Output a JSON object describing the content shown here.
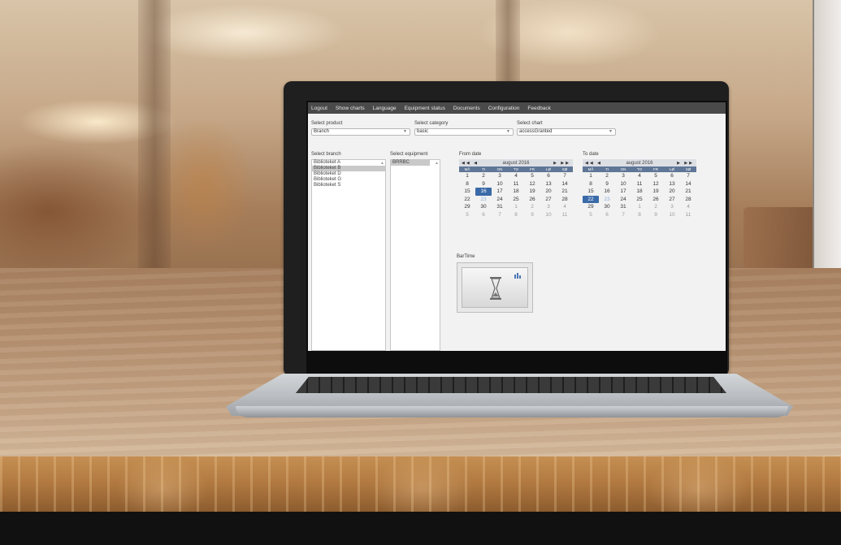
{
  "menu": [
    "Logout",
    "Show charts",
    "Language",
    "Equipment status",
    "Documents",
    "Configuration",
    "Feedback"
  ],
  "filters": {
    "product": {
      "label": "Select product",
      "value": "Branch"
    },
    "category": {
      "label": "Select category",
      "value": "basic"
    },
    "chart": {
      "label": "Select chart",
      "value": "accessGranted"
    }
  },
  "branch": {
    "label": "Select branch",
    "items": [
      "Biblioteket A",
      "Biblioteket B",
      "Biblioteket D",
      "Biblioteket G",
      "Biblioteket S"
    ],
    "selected_index": 1
  },
  "equipment": {
    "label": "Select equipment",
    "items": [
      "BRRBC"
    ],
    "selected_index": 0
  },
  "from_date": {
    "label": "From date",
    "month": "august 2016",
    "nav_prev": "◀◀ ◀",
    "nav_next": "▶ ▶▶",
    "weekdays": [
      "MÅ",
      "TI",
      "ON",
      "TO",
      "FR",
      "LØ",
      "SØ"
    ],
    "days": [
      "1",
      "2",
      "3",
      "4",
      "5",
      "6",
      "7",
      "8",
      "9",
      "10",
      "11",
      "12",
      "13",
      "14",
      "15",
      "16",
      "17",
      "18",
      "19",
      "20",
      "21",
      "22",
      "23",
      "24",
      "25",
      "26",
      "27",
      "28",
      "29",
      "30",
      "31",
      "1",
      "2",
      "3",
      "4",
      "5",
      "6",
      "7",
      "8",
      "9",
      "10",
      "11"
    ],
    "selected": "16"
  },
  "to_date": {
    "label": "To date",
    "month": "august 2016",
    "nav_prev": "◀◀ ◀",
    "nav_next": "▶ ▶▶",
    "weekdays": [
      "MÅ",
      "TI",
      "ON",
      "TO",
      "FR",
      "LØ",
      "SØ"
    ],
    "days": [
      "1",
      "2",
      "3",
      "4",
      "5",
      "6",
      "7",
      "8",
      "9",
      "10",
      "11",
      "12",
      "13",
      "14",
      "15",
      "16",
      "17",
      "18",
      "19",
      "20",
      "21",
      "22",
      "23",
      "24",
      "25",
      "26",
      "27",
      "28",
      "29",
      "30",
      "31",
      "1",
      "2",
      "3",
      "4",
      "5",
      "6",
      "7",
      "8",
      "9",
      "10",
      "11"
    ],
    "selected": "22"
  },
  "bartime": {
    "label": "BarTime",
    "icon": "hourglass-icon"
  },
  "colors": {
    "menubar": "#4a4a4a",
    "calendar_header": "#5f7697",
    "selected_day": "#3a6aa8"
  }
}
